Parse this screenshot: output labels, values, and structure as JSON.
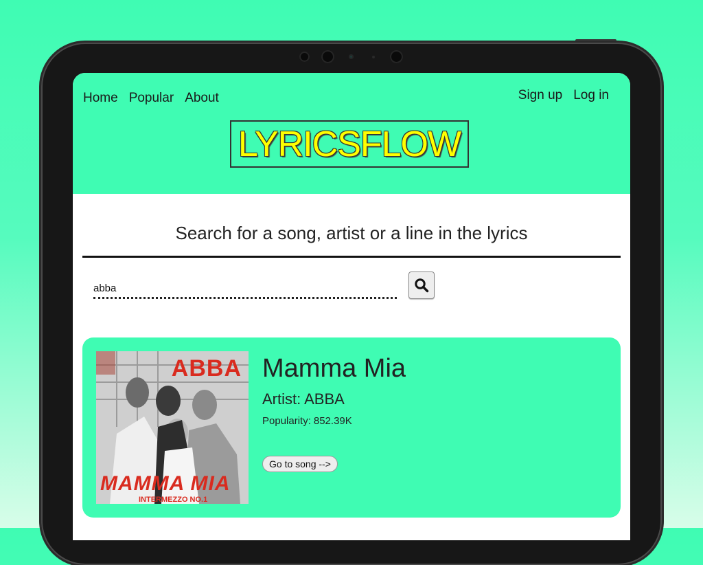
{
  "nav": {
    "home": "Home",
    "popular": "Popular",
    "about": "About",
    "signup": "Sign up",
    "login": "Log in"
  },
  "logo": {
    "text": "LYRICSFLOW"
  },
  "search": {
    "heading": "Search for a song, artist or a line in the lyrics",
    "value": "abba",
    "button_icon": "search-icon"
  },
  "result": {
    "title": "Mamma Mia",
    "artist": "Artist: ABBA",
    "popularity_label": "Popularity:",
    "popularity_value": "852.39K",
    "button_label": "Go to song -->",
    "album_art": {
      "band_text": "ABBA",
      "title_text": "MAMMA MIA",
      "sub_text": "INTERMEZZO NO.1"
    }
  },
  "colors": {
    "accent": "#3ffcb3",
    "logo_text": "#ffff00",
    "album_text": "#d92b1f"
  }
}
